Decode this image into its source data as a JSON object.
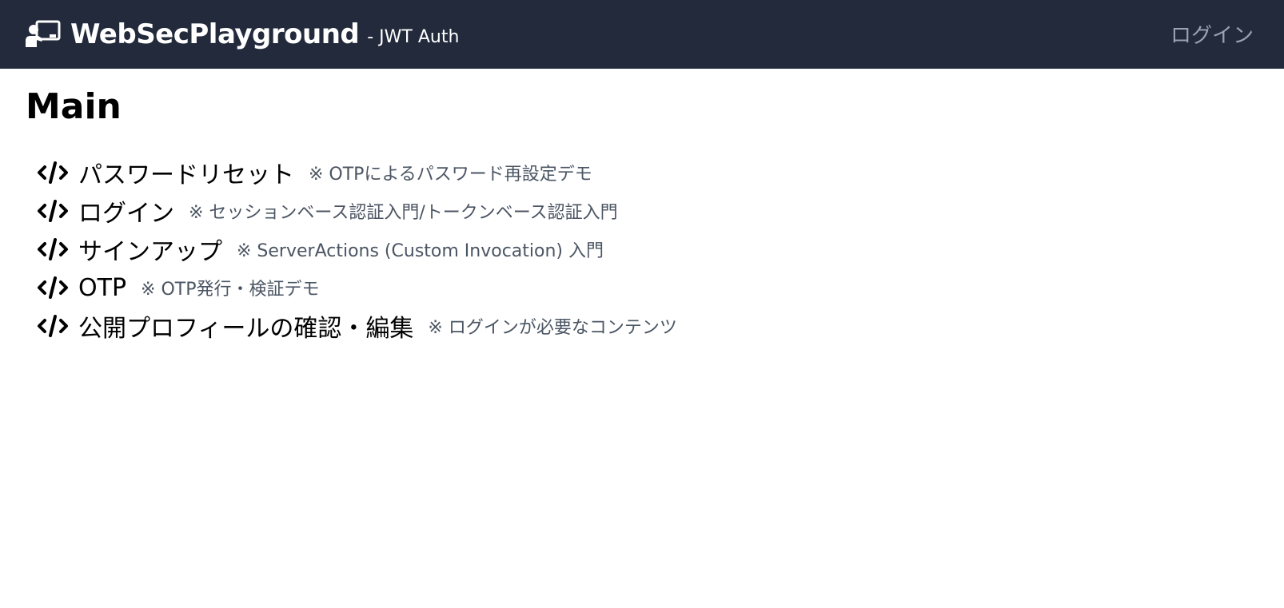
{
  "header": {
    "brand_name": "WebSecPlayground",
    "brand_sub": "- JWT Auth",
    "login_label": "ログイン",
    "brand_icon": "presentation-teacher-icon",
    "background_color": "#222a3b"
  },
  "main": {
    "title": "Main",
    "item_icon": "code-icon",
    "items": [
      {
        "label": "パスワードリセット",
        "note": "※ OTPによるパスワード再設定デモ"
      },
      {
        "label": "ログイン",
        "note": "※ セッションベース認証入門/トークンベース認証入門"
      },
      {
        "label": "サインアップ",
        "note": "※ ServerActions (Custom Invocation) 入門"
      },
      {
        "label": "OTP",
        "note": "※ OTP発行・検証デモ"
      },
      {
        "label": "公開プロフィールの確認・編集",
        "note": "※ ログインが必要なコンテンツ"
      }
    ]
  }
}
